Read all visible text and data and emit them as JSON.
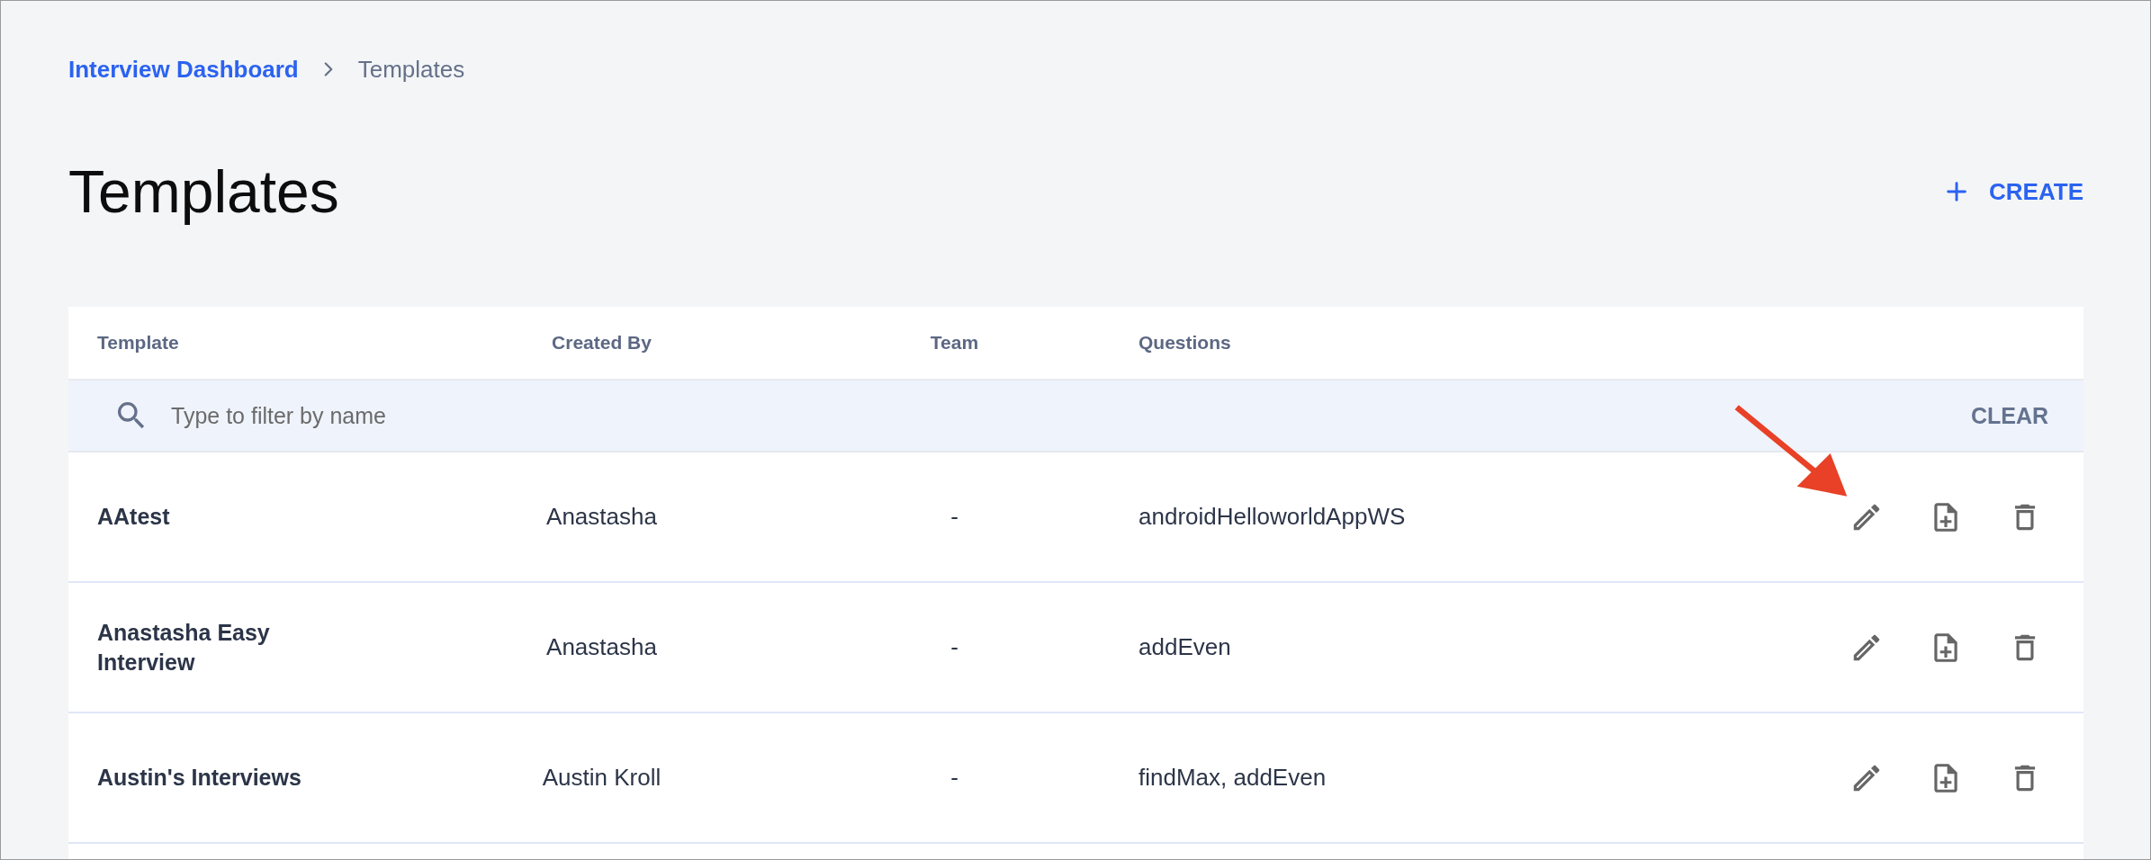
{
  "breadcrumb": [
    {
      "label": "Interview Dashboard",
      "kind": "link"
    },
    {
      "label": "Templates",
      "kind": "current"
    }
  ],
  "page_title": "Templates",
  "create_button": {
    "label": "CREATE"
  },
  "table": {
    "columns": [
      "Template",
      "Created By",
      "Team",
      "Questions"
    ],
    "filter": {
      "placeholder": "Type to filter by name",
      "clear_label": "CLEAR"
    },
    "rows": [
      {
        "template": "AAtest",
        "created_by": "Anastasha",
        "team": "-",
        "questions": "androidHelloworldAppWS"
      },
      {
        "template": "Anastasha Easy Interview",
        "created_by": "Anastasha",
        "team": "-",
        "questions": "addEven"
      },
      {
        "template": "Austin's Interviews",
        "created_by": "Austin Kroll",
        "team": "-",
        "questions": "findMax, addEven"
      }
    ]
  }
}
